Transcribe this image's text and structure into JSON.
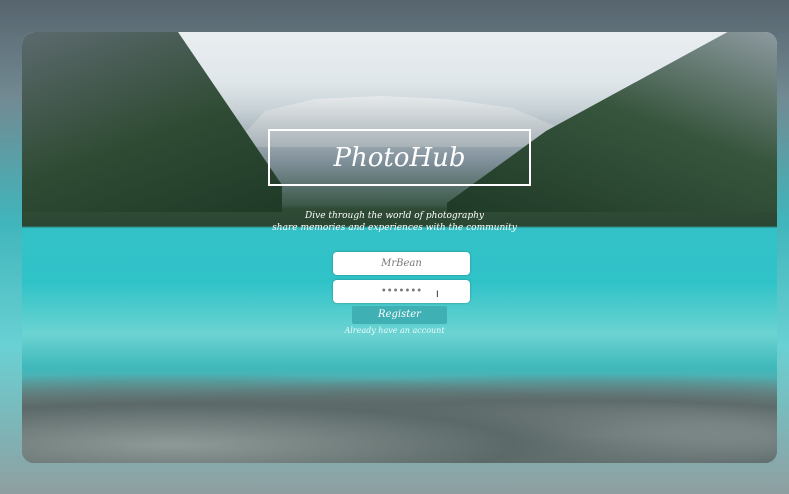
{
  "app": {
    "title": "PhotoHub"
  },
  "tagline": [
    "Dive through the world of photography",
    "share memories and experiences with the community"
  ],
  "form": {
    "username_value": "MrBean",
    "password_value": "•••••••",
    "register_label": "Register",
    "login_link": "Already have an account"
  },
  "colors": {
    "accent": "#3fb0b3"
  }
}
